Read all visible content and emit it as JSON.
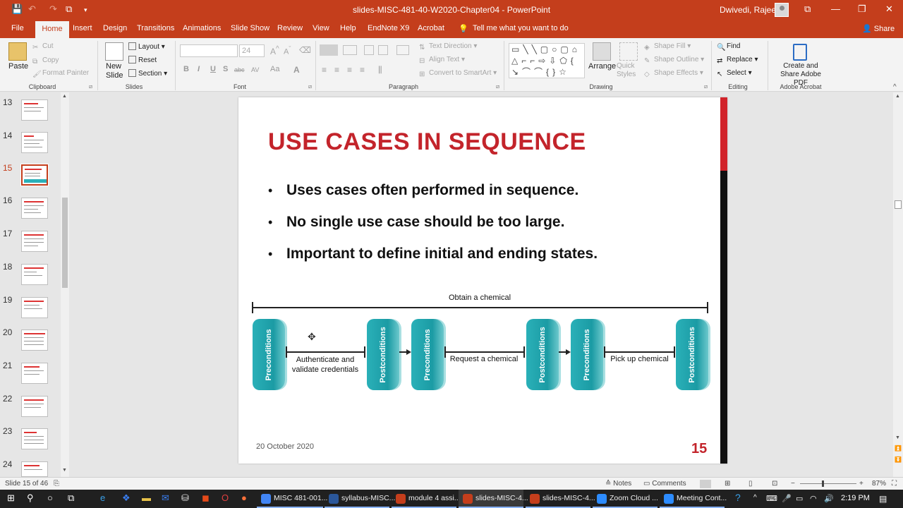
{
  "window": {
    "title": "slides-MISC-481-40-W2020-Chapter04  -  PowerPoint",
    "user": "Dwivedi, Rajeev",
    "controls": {
      "ribbon_display": "⧉",
      "minimize": "—",
      "maximize": "❐",
      "close": "✕"
    }
  },
  "quick_access": {
    "save": "💾",
    "undo": "↶",
    "redo": "↷",
    "start": "⧉",
    "more": "▾"
  },
  "tabs": [
    "File",
    "Home",
    "Insert",
    "Design",
    "Transitions",
    "Animations",
    "Slide Show",
    "Review",
    "View",
    "Help",
    "EndNote X9",
    "Acrobat"
  ],
  "tell_me": "Tell me what you want to do",
  "share": "Share",
  "ribbon": {
    "clipboard": {
      "label": "Clipboard",
      "paste": "Paste",
      "cut": "Cut",
      "copy": "Copy",
      "format_painter": "Format Painter"
    },
    "slides": {
      "label": "Slides",
      "new_slide": "New Slide",
      "layout": "Layout",
      "reset": "Reset",
      "section": "Section"
    },
    "font": {
      "label": "Font",
      "font_size": "24",
      "bold": "B",
      "italic": "I",
      "underline": "U",
      "shadow": "S",
      "strike": "abc",
      "spacing": "AV",
      "case": "Aa",
      "color": "A"
    },
    "paragraph": {
      "label": "Paragraph",
      "text_direction": "Text Direction",
      "align_text": "Align Text",
      "smartart": "Convert to SmartArt"
    },
    "drawing": {
      "label": "Drawing",
      "arrange": "Arrange",
      "quick_styles": "Quick Styles",
      "shape_fill": "Shape Fill",
      "shape_outline": "Shape Outline",
      "shape_effects": "Shape Effects"
    },
    "editing": {
      "label": "Editing",
      "find": "Find",
      "replace": "Replace",
      "select": "Select"
    },
    "acrobat": {
      "label": "Adobe Acrobat",
      "create": "Create and Share Adobe PDF"
    }
  },
  "thumbnails": [
    {
      "num": "13"
    },
    {
      "num": "14"
    },
    {
      "num": "15",
      "selected": true
    },
    {
      "num": "16"
    },
    {
      "num": "17"
    },
    {
      "num": "18"
    },
    {
      "num": "19"
    },
    {
      "num": "20"
    },
    {
      "num": "21"
    },
    {
      "num": "22"
    },
    {
      "num": "23"
    },
    {
      "num": "24"
    }
  ],
  "slide": {
    "title": "USE CASES IN SEQUENCE",
    "bullets": [
      "Uses cases often performed in sequence.",
      "No single use case should be too large.",
      "Important to define initial and ending states."
    ],
    "diagram": {
      "overall": "Obtain a chemical",
      "pre": "Preconditions",
      "post": "Postconditions",
      "steps": [
        "Authenticate and validate credentials",
        "Request a chemical",
        "Pick up chemical"
      ]
    },
    "date": "20 October 2020",
    "number": "15"
  },
  "status": {
    "slide_info": "Slide 15 of 46",
    "notes": "Notes",
    "comments": "Comments",
    "zoom": "87%"
  },
  "taskbar": {
    "apps": [
      {
        "label": "MISC 481-001...",
        "color": "#4285f4"
      },
      {
        "label": "syllabus-MISC...",
        "color": "#2b579a"
      },
      {
        "label": "module 4 assi...",
        "color": "#c43e1c"
      },
      {
        "label": "slides-MISC-4...",
        "color": "#c43e1c",
        "active": true
      },
      {
        "label": "slides-MISC-4...",
        "color": "#c43e1c"
      },
      {
        "label": "Zoom Cloud ...",
        "color": "#2d8cff"
      },
      {
        "label": "Meeting Cont...",
        "color": "#2d8cff"
      }
    ],
    "time": "2:19 PM"
  }
}
